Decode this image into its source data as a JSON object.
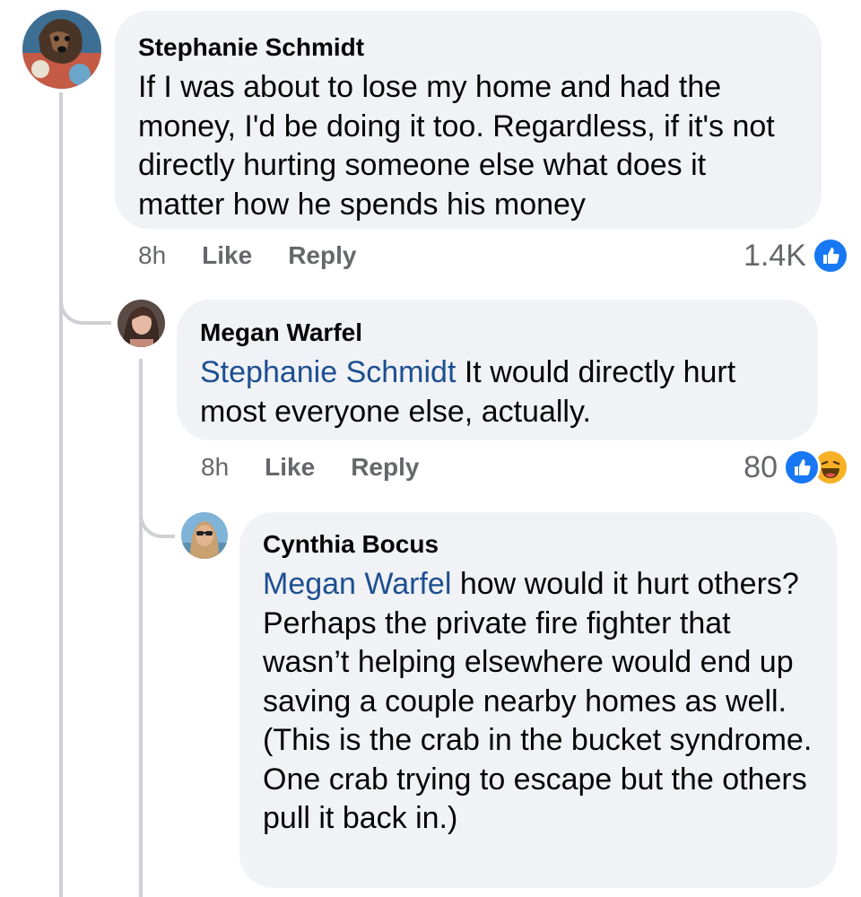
{
  "comments": [
    {
      "author": "Stephanie Schmidt",
      "mention": "",
      "text": "If I was about to lose my home and had the money, I'd be doing it too.  Regardless, if it's not directly hurting someone else what does it matter how he spends his money",
      "time": "8h",
      "like_label": "Like",
      "reply_label": "Reply",
      "reaction_count": "1.4K"
    },
    {
      "author": "Megan Warfel",
      "mention": "Stephanie Schmidt",
      "text": " It would directly hurt most everyone else, actually.",
      "time": "8h",
      "like_label": "Like",
      "reply_label": "Reply",
      "reaction_count": "80"
    },
    {
      "author": "Cynthia Bocus",
      "mention": "Megan Warfel",
      "text": " how would it hurt others? Perhaps the private fire fighter that wasn’t helping elsewhere would end up saving a couple nearby homes as well. (This is the crab in the bucket syndrome. One crab trying to escape but the others pull it back in.)"
    }
  ],
  "colors": {
    "bubble": "#f0f2f5",
    "mention": "#1d4f91",
    "meta": "#65676b",
    "like_reaction": "#1877f2",
    "haha_reaction": "#f7b125",
    "thread_line": "#ced0d4"
  },
  "icons": {
    "like_reaction": "thumbs-up-icon",
    "haha_reaction": "laughing-face-icon"
  }
}
